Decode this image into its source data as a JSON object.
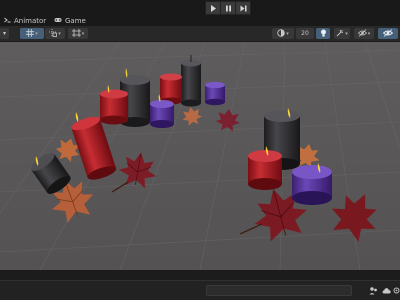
{
  "window": {
    "play_controls": [
      {
        "name": "play-button",
        "icon": "play-icon"
      },
      {
        "name": "pause-button",
        "icon": "pause-icon"
      },
      {
        "name": "step-button",
        "icon": "step-forward-icon"
      }
    ]
  },
  "tabs": [
    {
      "label": "Animator",
      "icon": "animator-icon"
    },
    {
      "label": "Game",
      "icon": "gamepad-icon"
    }
  ],
  "toolbar": {
    "grid_snap_value": "20",
    "colors": {
      "active": "#46607a",
      "button": "#383838"
    }
  },
  "scene": {
    "description_objects": [
      "candles",
      "autumn-leaves"
    ],
    "colors": {
      "floor": "#585656",
      "grid": "#6a6868",
      "candle_red": "#b8232a",
      "candle_black": "#2e2e30",
      "candle_purple": "#5b3aa0",
      "flame": "#f5d23c",
      "leaf_red": "#7a1a22",
      "leaf_orange": "#b5603a"
    }
  }
}
